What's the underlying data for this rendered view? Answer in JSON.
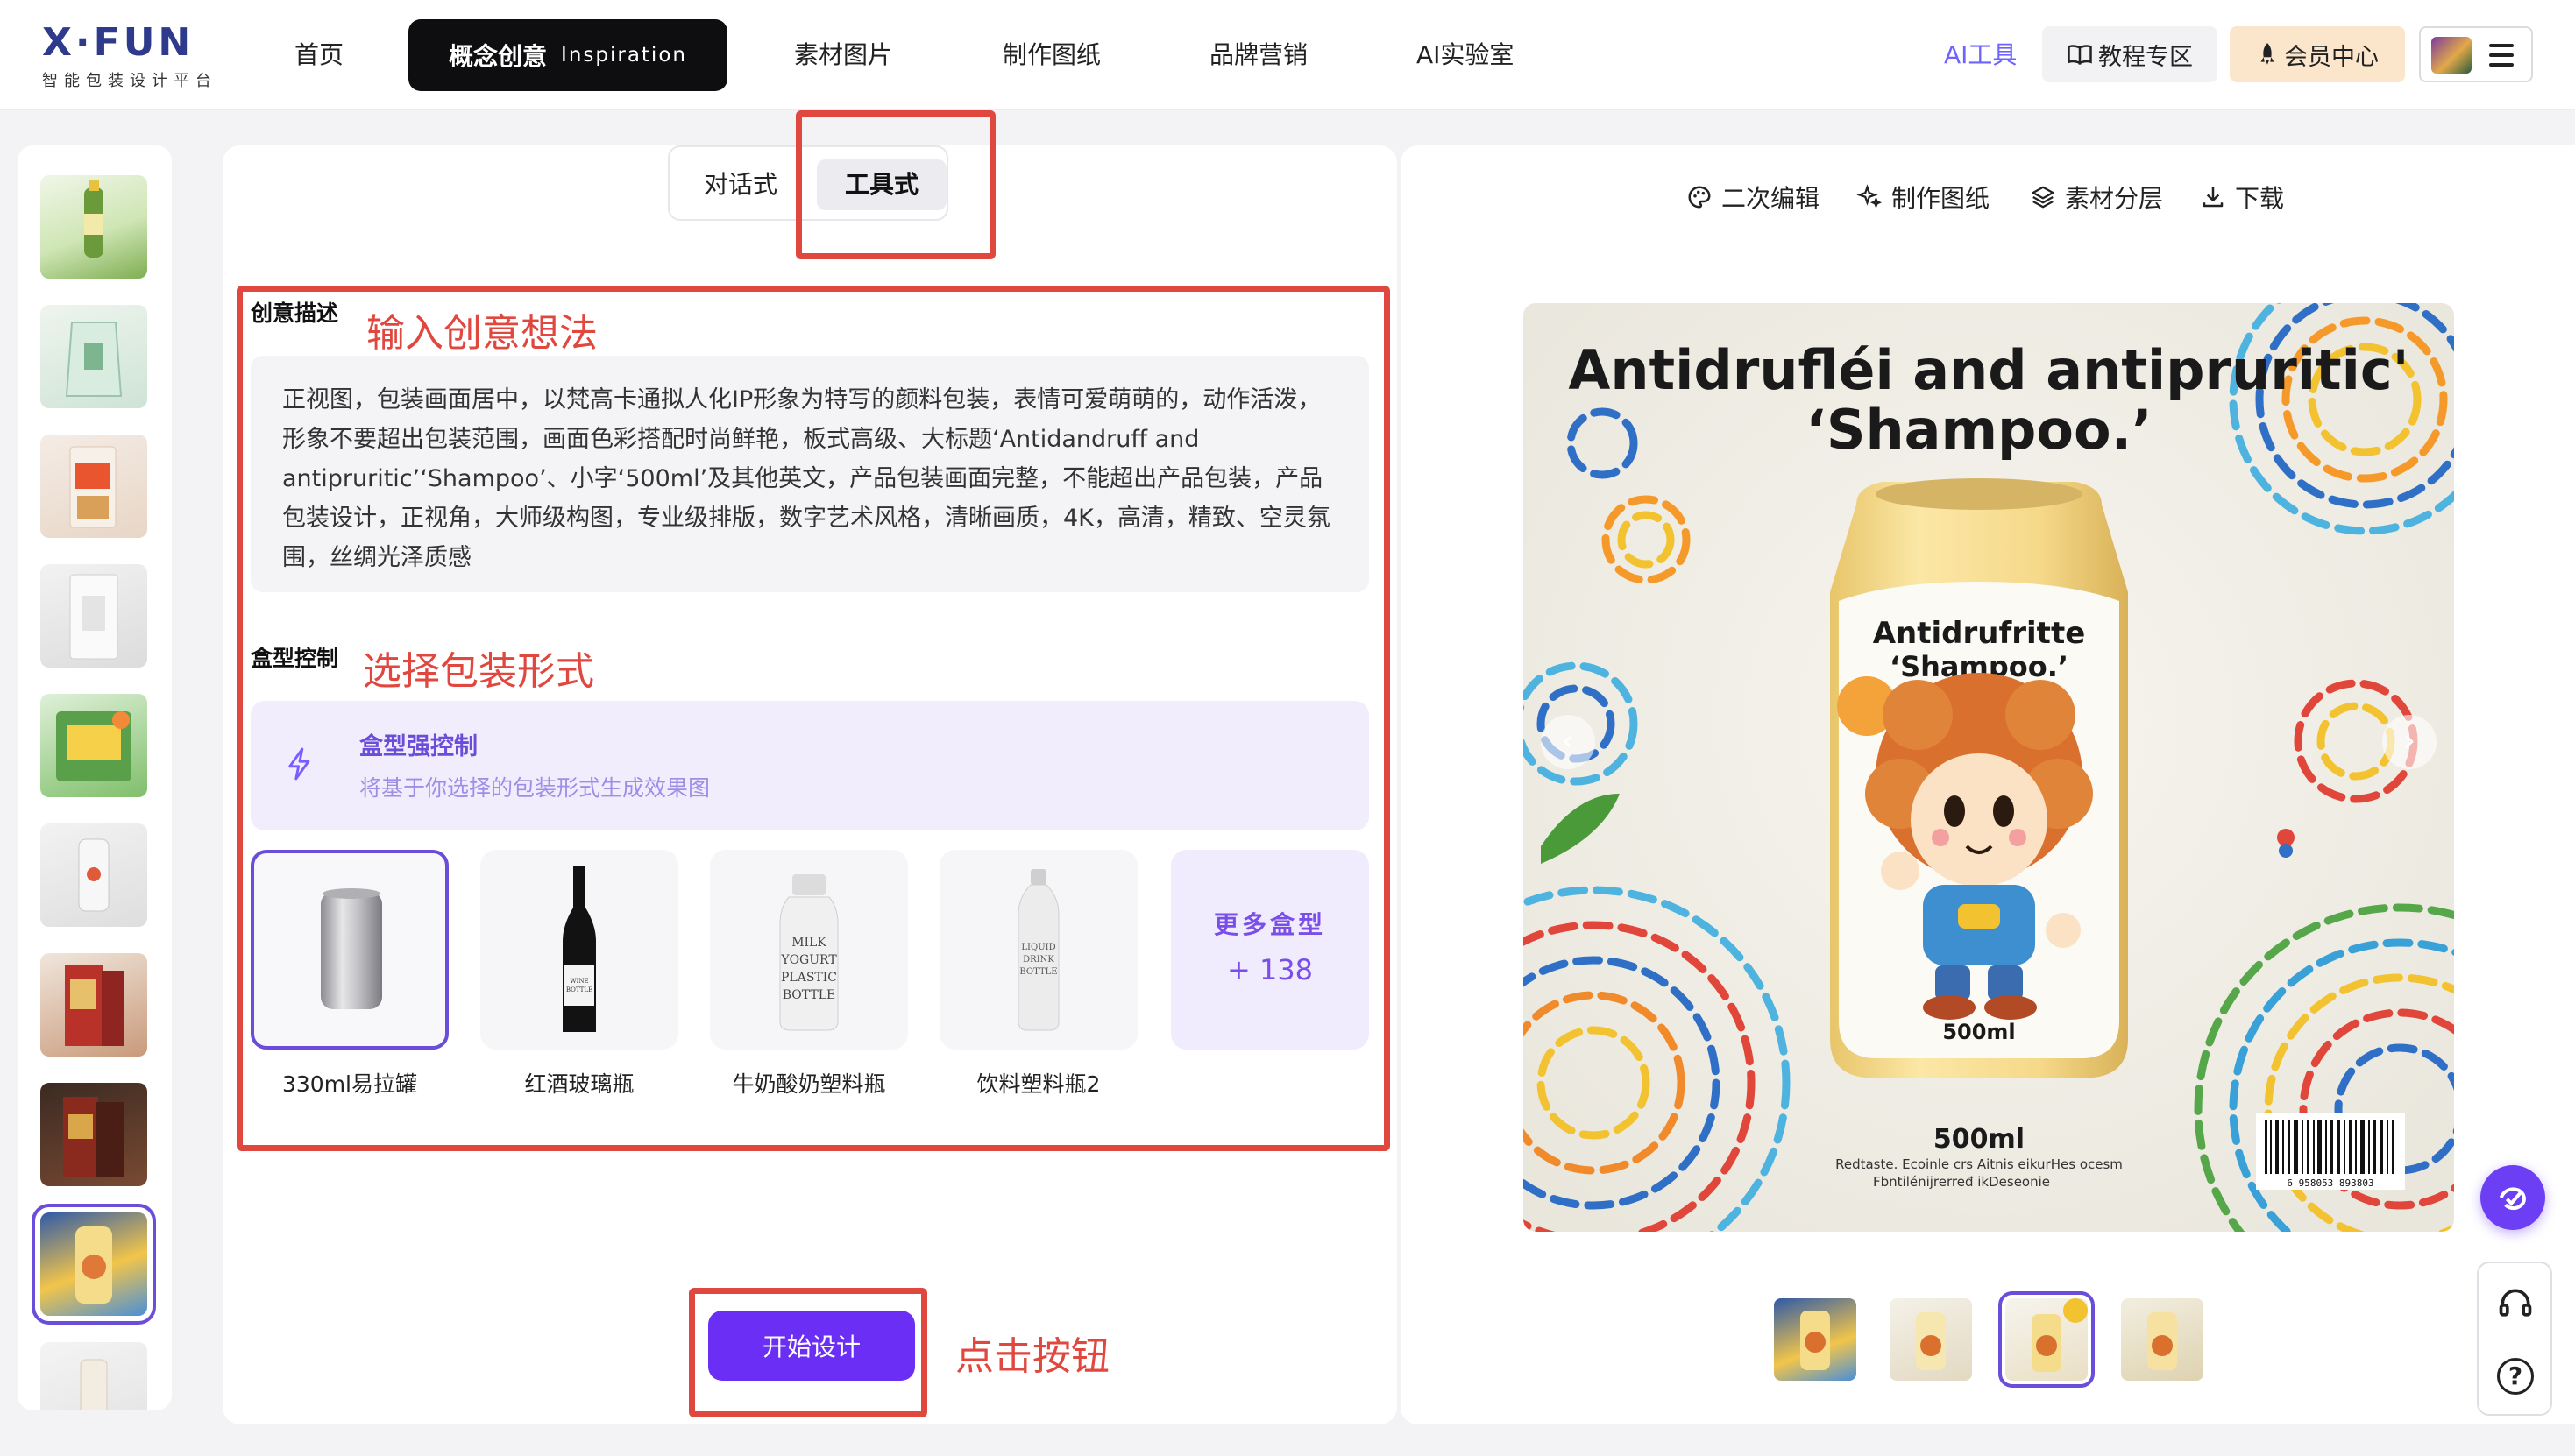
{
  "app": {
    "logo": "X·FUN",
    "logo_sub": "智能包装设计平台"
  },
  "nav": {
    "home": "首页",
    "active_zh": "概念创意",
    "active_en": "Inspiration",
    "materials": "素材图片",
    "drawings": "制作图纸",
    "marketing": "品牌营销",
    "ai_lab": "AI实验室",
    "ai_tools": "AI工具",
    "tutorial": "教程专区",
    "member": "会员中心"
  },
  "mode": {
    "chat": "对话式",
    "tool": "工具式"
  },
  "form": {
    "desc_title": "创意描述",
    "desc_annotation": "输入创意想法",
    "desc_text": "正视图，包装画面居中，以梵高卡通拟人化IP形象为特写的颜料包装，表情可爱萌萌的，动作活泼，形象不要超出包装范围，画面色彩搭配时尚鲜艳，板式高级、大标题‘Antidandruff and antipruritic’‘Shampoo’、小字‘500ml’及其他英文，产品包装画面完整，不能超出产品包装，产品包装设计，正视角，大师级构图，专业级排版，数字艺术风格，清晰画质，4K，高清，精致、空灵氛围，丝绸光泽质感",
    "box_title": "盒型控制",
    "box_annotation": "选择包装形式",
    "strong_title": "盒型强控制",
    "strong_sub": "将基于你选择的包装形式生成效果图",
    "boxes": [
      {
        "label": "330ml易拉罐"
      },
      {
        "label": "红酒玻璃瓶"
      },
      {
        "label": "牛奶酸奶塑料瓶"
      },
      {
        "label": "饮料塑料瓶2"
      }
    ],
    "more_title": "更多盒型",
    "more_count": "+ 138",
    "start_button": "开始设计",
    "click_annotation": "点击按钮",
    "bottle_text_wine": "WINE BOTTLE",
    "bottle_text_milk": [
      "MILK",
      "YOGURT",
      "PLASTIC",
      "BOTTLE"
    ],
    "bottle_text_liquid": [
      "LIQUID",
      "DRINK",
      "BOTTLE"
    ]
  },
  "preview": {
    "tools": {
      "edit": "二次编辑",
      "drawing": "制作图纸",
      "layers": "素材分层",
      "download": "下载"
    },
    "headline_1": "Antidrufléi and antipruritic'",
    "headline_2": "‘Shampoo.’",
    "can_title_1": "Antidrufritte",
    "can_title_2": "‘Shampoo.’",
    "can_volume": "500ml",
    "bottom_volume": "500ml",
    "bottom_line_1": "Redtaste. Ecoinle crs Aitnis eikurHes ocesm",
    "bottom_line_2": "Fbntilénijrerređ ikDeseonie",
    "barcode_number": "6 958053 893803"
  },
  "colors": {
    "accent": "#6a2ef5",
    "annotation": "#e0473f"
  }
}
